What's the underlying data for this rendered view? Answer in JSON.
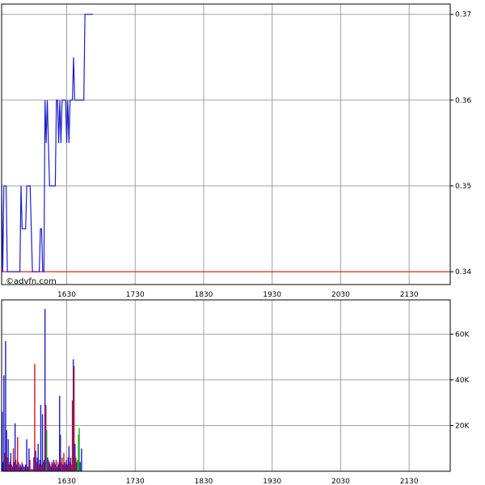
{
  "watermark": "©advfn.com",
  "colors": {
    "price_line": "#1d1dcc",
    "reference_line": "#e60000",
    "grid": "#a0a0a0",
    "vol_up": "#1d1dcc",
    "vol_down": "#dd1111",
    "vol_neutral": "#22aa22"
  },
  "chart_data": [
    {
      "type": "line",
      "panel": "price",
      "x_tick_labels": [
        "1630",
        "1730",
        "1830",
        "1930",
        "2030",
        "2130"
      ],
      "x_ticks_minutes": [
        990,
        1050,
        1110,
        1170,
        1230,
        1290
      ],
      "xlim_minutes": [
        933,
        1326
      ],
      "ylim": [
        0.3385,
        0.3712
      ],
      "y_ticks": [
        0.34,
        0.35,
        0.36,
        0.37
      ],
      "y_tick_labels": [
        "0.34",
        "0.35",
        "0.36",
        "0.37"
      ],
      "reference_value": 0.34,
      "grid": true,
      "series": [
        {
          "x_minutes": [
            933,
            934,
            935,
            937,
            938,
            940,
            941,
            942,
            943,
            944,
            945,
            946,
            947,
            948,
            949,
            950,
            951,
            952,
            953,
            954,
            955,
            956,
            957,
            958,
            959,
            960,
            961,
            962,
            963,
            964,
            965,
            966,
            967,
            968,
            969,
            970,
            971,
            972,
            973,
            974,
            975,
            976,
            977,
            978,
            979,
            980,
            981,
            982,
            983,
            984,
            985,
            986,
            987,
            988,
            989,
            990,
            991,
            992,
            993,
            994,
            995,
            996,
            997,
            998,
            999,
            1000,
            1001,
            1002,
            1003,
            1004,
            1005,
            1006,
            1007,
            1008,
            1009,
            1010,
            1011,
            1012,
            1013
          ],
          "values": [
            0.35,
            0.34,
            0.35,
            0.35,
            0.34,
            0.34,
            0.34,
            0.34,
            0.34,
            0.34,
            0.34,
            0.34,
            0.34,
            0.34,
            0.34,
            0.35,
            0.345,
            0.345,
            0.345,
            0.345,
            0.35,
            0.35,
            0.35,
            0.35,
            0.345,
            0.34,
            0.34,
            0.34,
            0.34,
            0.34,
            0.34,
            0.34,
            0.345,
            0.345,
            0.34,
            0.34,
            0.36,
            0.355,
            0.36,
            0.355,
            0.35,
            0.35,
            0.35,
            0.35,
            0.35,
            0.35,
            0.36,
            0.36,
            0.355,
            0.36,
            0.355,
            0.36,
            0.36,
            0.36,
            0.36,
            0.355,
            0.36,
            0.355,
            0.36,
            0.36,
            0.36,
            0.365,
            0.36,
            0.36,
            0.36,
            0.36,
            0.36,
            0.36,
            0.36,
            0.36,
            0.36,
            0.37,
            0.37,
            0.37,
            0.37,
            0.37,
            0.37,
            0.37,
            0.37
          ]
        }
      ]
    },
    {
      "type": "bar",
      "panel": "volume",
      "x_tick_labels": [
        "1630",
        "1730",
        "1830",
        "1930",
        "2030",
        "2130"
      ],
      "x_ticks_minutes": [
        990,
        1050,
        1110,
        1170,
        1230,
        1290
      ],
      "xlim_minutes": [
        933,
        1326
      ],
      "ylim": [
        0,
        75000
      ],
      "y_ticks": [
        20000,
        40000,
        60000
      ],
      "y_tick_labels": [
        "20K",
        "40K",
        "60K"
      ],
      "grid": true,
      "bars": [
        {
          "x": 933.5,
          "v": 26000,
          "c": "up"
        },
        {
          "x": 934.2,
          "v": 4000,
          "c": "up"
        },
        {
          "x": 935.0,
          "v": 42000,
          "c": "up"
        },
        {
          "x": 935.8,
          "v": 8000,
          "c": "down"
        },
        {
          "x": 936.5,
          "v": 57000,
          "c": "up"
        },
        {
          "x": 937.3,
          "v": 18000,
          "c": "up"
        },
        {
          "x": 938.0,
          "v": 6000,
          "c": "down"
        },
        {
          "x": 938.8,
          "v": 14000,
          "c": "up"
        },
        {
          "x": 939.5,
          "v": 3000,
          "c": "down"
        },
        {
          "x": 940.3,
          "v": 4000,
          "c": "up"
        },
        {
          "x": 941.0,
          "v": 8000,
          "c": "up"
        },
        {
          "x": 941.8,
          "v": 3000,
          "c": "down"
        },
        {
          "x": 942.5,
          "v": 2000,
          "c": "up"
        },
        {
          "x": 943.3,
          "v": 10000,
          "c": "down"
        },
        {
          "x": 944.0,
          "v": 4000,
          "c": "up"
        },
        {
          "x": 944.8,
          "v": 21000,
          "c": "up"
        },
        {
          "x": 945.5,
          "v": 5000,
          "c": "down"
        },
        {
          "x": 946.3,
          "v": 3000,
          "c": "up"
        },
        {
          "x": 947.0,
          "v": 15000,
          "c": "down"
        },
        {
          "x": 947.8,
          "v": 4000,
          "c": "up"
        },
        {
          "x": 948.5,
          "v": 2000,
          "c": "down"
        },
        {
          "x": 949.3,
          "v": 3000,
          "c": "up"
        },
        {
          "x": 950.0,
          "v": 2000,
          "c": "up"
        },
        {
          "x": 950.8,
          "v": 4000,
          "c": "down"
        },
        {
          "x": 951.5,
          "v": 3000,
          "c": "up"
        },
        {
          "x": 952.5,
          "v": 2000,
          "c": "down"
        },
        {
          "x": 953.3,
          "v": 2000,
          "c": "down"
        },
        {
          "x": 954.0,
          "v": 3000,
          "c": "up"
        },
        {
          "x": 955.0,
          "v": 14000,
          "c": "up"
        },
        {
          "x": 956.0,
          "v": 2000,
          "c": "up"
        },
        {
          "x": 957.0,
          "v": 10000,
          "c": "up"
        },
        {
          "x": 957.8,
          "v": 5000,
          "c": "down"
        },
        {
          "x": 958.8,
          "v": 1000,
          "c": "down"
        },
        {
          "x": 960.0,
          "v": 1000,
          "c": "up"
        },
        {
          "x": 961.2,
          "v": 6000,
          "c": "up"
        },
        {
          "x": 962.0,
          "v": 47000,
          "c": "down"
        },
        {
          "x": 962.8,
          "v": 9000,
          "c": "up"
        },
        {
          "x": 963.5,
          "v": 4000,
          "c": "down"
        },
        {
          "x": 964.3,
          "v": 6000,
          "c": "up"
        },
        {
          "x": 965.0,
          "v": 12000,
          "c": "up"
        },
        {
          "x": 965.8,
          "v": 3000,
          "c": "down"
        },
        {
          "x": 966.5,
          "v": 5000,
          "c": "up"
        },
        {
          "x": 967.3,
          "v": 29000,
          "c": "up"
        },
        {
          "x": 968.0,
          "v": 3000,
          "c": "down"
        },
        {
          "x": 968.8,
          "v": 25000,
          "c": "up"
        },
        {
          "x": 969.5,
          "v": 4000,
          "c": "down"
        },
        {
          "x": 970.3,
          "v": 5000,
          "c": "up"
        },
        {
          "x": 971.0,
          "v": 71000,
          "c": "up"
        },
        {
          "x": 971.8,
          "v": 29000,
          "c": "down"
        },
        {
          "x": 972.5,
          "v": 18000,
          "c": "neutral"
        },
        {
          "x": 973.3,
          "v": 6000,
          "c": "up"
        },
        {
          "x": 974.0,
          "v": 5000,
          "c": "down"
        },
        {
          "x": 974.8,
          "v": 4000,
          "c": "up"
        },
        {
          "x": 975.5,
          "v": 3000,
          "c": "down"
        },
        {
          "x": 976.3,
          "v": 2000,
          "c": "up"
        },
        {
          "x": 977.0,
          "v": 4000,
          "c": "up"
        },
        {
          "x": 977.8,
          "v": 3000,
          "c": "down"
        },
        {
          "x": 978.5,
          "v": 5000,
          "c": "up"
        },
        {
          "x": 979.3,
          "v": 4000,
          "c": "down"
        },
        {
          "x": 980.0,
          "v": 3000,
          "c": "up"
        },
        {
          "x": 980.8,
          "v": 5000,
          "c": "down"
        },
        {
          "x": 981.5,
          "v": 2000,
          "c": "up"
        },
        {
          "x": 982.3,
          "v": 4000,
          "c": "down"
        },
        {
          "x": 983.0,
          "v": 3000,
          "c": "up"
        },
        {
          "x": 983.8,
          "v": 33000,
          "c": "up"
        },
        {
          "x": 984.5,
          "v": 16000,
          "c": "up"
        },
        {
          "x": 985.3,
          "v": 4000,
          "c": "down"
        },
        {
          "x": 986.0,
          "v": 6000,
          "c": "down"
        },
        {
          "x": 986.8,
          "v": 3000,
          "c": "up"
        },
        {
          "x": 987.5,
          "v": 8000,
          "c": "down"
        },
        {
          "x": 988.3,
          "v": 4000,
          "c": "up"
        },
        {
          "x": 989.0,
          "v": 3000,
          "c": "down"
        },
        {
          "x": 989.8,
          "v": 5000,
          "c": "up"
        },
        {
          "x": 990.5,
          "v": 3000,
          "c": "up"
        },
        {
          "x": 991.3,
          "v": 6000,
          "c": "down"
        },
        {
          "x": 992.0,
          "v": 11000,
          "c": "up"
        },
        {
          "x": 992.8,
          "v": 4000,
          "c": "down"
        },
        {
          "x": 993.5,
          "v": 6000,
          "c": "up"
        },
        {
          "x": 994.3,
          "v": 3000,
          "c": "down"
        },
        {
          "x": 995.0,
          "v": 31000,
          "c": "down"
        },
        {
          "x": 995.8,
          "v": 49000,
          "c": "up"
        },
        {
          "x": 996.5,
          "v": 46000,
          "c": "down"
        },
        {
          "x": 997.3,
          "v": 12000,
          "c": "up"
        },
        {
          "x": 998.0,
          "v": 6000,
          "c": "down"
        },
        {
          "x": 998.8,
          "v": 4000,
          "c": "up"
        },
        {
          "x": 999.5,
          "v": 5000,
          "c": "neutral"
        },
        {
          "x": 1000.3,
          "v": 16000,
          "c": "neutral"
        },
        {
          "x": 1001.0,
          "v": 19000,
          "c": "neutral"
        },
        {
          "x": 1001.8,
          "v": 4000,
          "c": "up"
        },
        {
          "x": 1003.0,
          "v": 10000,
          "c": "up"
        }
      ]
    }
  ]
}
